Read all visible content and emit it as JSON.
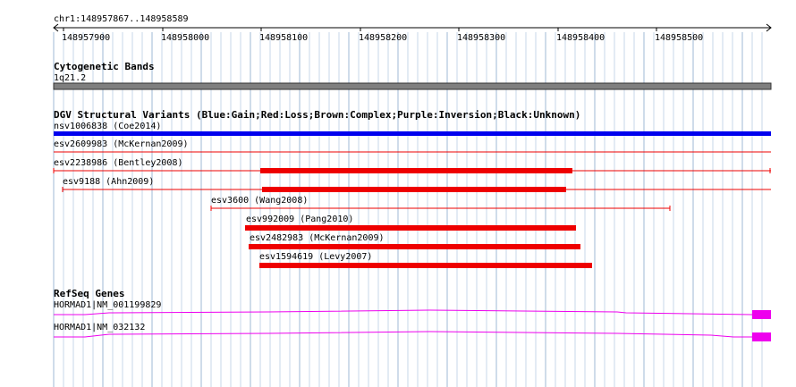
{
  "region": {
    "label": "chr1:148957867..148958589",
    "ticks": [
      "148957900",
      "148958000",
      "148958100",
      "148958200",
      "148958300",
      "148958400",
      "148958500"
    ]
  },
  "tracks": {
    "cytoband": {
      "title": "Cytogenetic Bands",
      "band": "1q21.2"
    },
    "dgv": {
      "title": "DGV Structural Variants (Blue:Gain;Red:Loss;Brown:Complex;Purple:Inversion;Black:Unknown)",
      "features": [
        {
          "name": "nsv1006838 (Coe2014)",
          "color": "#0000ee",
          "type": "gain"
        },
        {
          "name": "esv2609983 (McKernan2009)",
          "color": "#ee0000",
          "type": "loss"
        },
        {
          "name": "esv2238986 (Bentley2008)",
          "color": "#ee0000",
          "type": "loss"
        },
        {
          "name": "esv9188 (Ahn2009)",
          "color": "#ee0000",
          "type": "loss"
        },
        {
          "name": "esv3600 (Wang2008)",
          "color": "#ee0000",
          "type": "loss"
        },
        {
          "name": "esv992009 (Pang2010)",
          "color": "#ee0000",
          "type": "loss"
        },
        {
          "name": "esv2482983 (McKernan2009)",
          "color": "#ee0000",
          "type": "loss"
        },
        {
          "name": "esv1594619 (Levy2007)",
          "color": "#ee0000",
          "type": "loss"
        }
      ]
    },
    "refseq": {
      "title": "RefSeq Genes",
      "color": "#ee00ee",
      "transcripts": [
        {
          "name": "HORMAD1|NM_001199829"
        },
        {
          "name": "HORMAD1|NM_032132"
        }
      ]
    }
  }
}
